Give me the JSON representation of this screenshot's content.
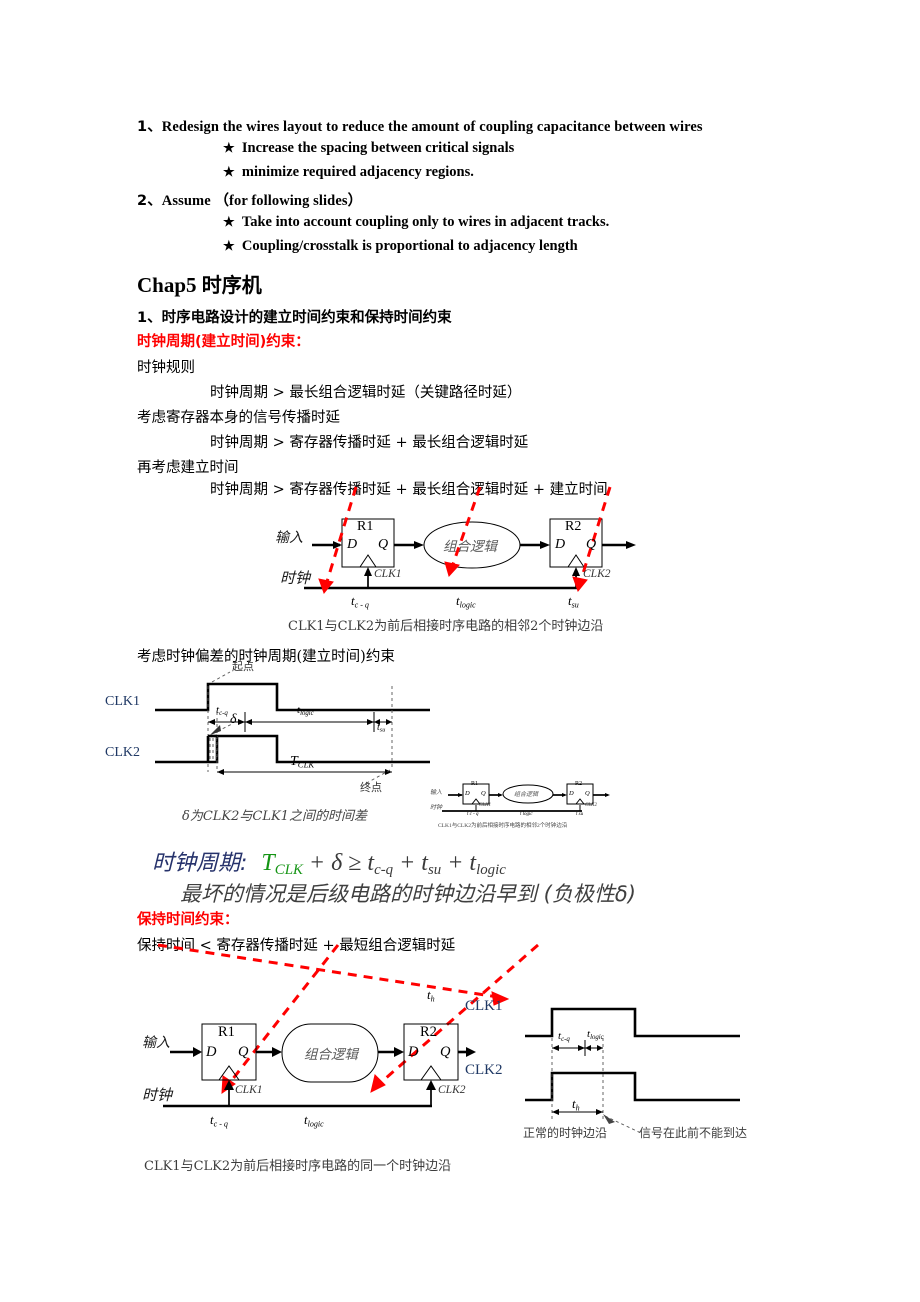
{
  "document": {
    "title": "Chap5 时序机"
  },
  "top_section": {
    "item1": {
      "number": "1、",
      "text": "Redesign the wires layout to reduce the amount of coupling capacitance between wires",
      "bullets": [
        {
          "marker": "★",
          "text": "Increase the spacing between critical signals"
        },
        {
          "marker": "★",
          "text": "minimize required adjacency regions."
        }
      ]
    },
    "item2": {
      "number": "2、",
      "text": "Assume  （for following slides）",
      "bullets": [
        {
          "marker": "★",
          "text": "Take into account coupling only to wires in adjacent tracks."
        },
        {
          "marker": "★",
          "text": "Coupling/crosstalk is proportional to adjacency length"
        }
      ]
    }
  },
  "chapter": {
    "prefix": "Chap5",
    "name": "时序机"
  },
  "setup_section": {
    "heading": "1、时序电路设计的建立时间约束和保持时间约束",
    "red_heading": "时钟周期(建立时间)约束：",
    "lines": [
      "时钟规则",
      "时钟周期  >   最长组合逻辑时延（关键路径时延）",
      "考虑寄存器本身的信号传播时延",
      "时钟周期  >  寄存器传播时延 +  最长组合逻辑时延",
      "再考虑建立时间",
      "时钟周期  >  寄存器传播时延 + 最长组合逻辑时延 + 建立时间"
    ],
    "skew_heading": "考虑时钟偏差的时钟周期(建立时间)约束"
  },
  "circuit1": {
    "input_label": "输入",
    "clock_label": "时钟",
    "reg1": "R1",
    "reg2": "R2",
    "d": "D",
    "q": "Q",
    "logic": "组合逻辑",
    "clk1": "CLK1",
    "clk2": "CLK2",
    "t_cq": "t",
    "t_cq_sub": "c - q",
    "t_logic": "t",
    "t_logic_sub": "logic",
    "t_su": "t",
    "t_su_sub": "su",
    "caption": "CLK1与CLK2为前后相接时序电路的相邻2个时钟边沿"
  },
  "waveform1": {
    "clk1": "CLK1",
    "clk2": "CLK2",
    "start_point": "起点",
    "end_point": "终点",
    "t_cq": "t",
    "t_cq_sub": "c-q",
    "t_logic": "t",
    "t_logic_sub": "logic",
    "t_su": "t",
    "t_su_sub": "su",
    "t_clk": "T",
    "t_clk_sub": "CLK",
    "delta": "δ",
    "caption": "δ为CLK2与CLK1之间的时间差"
  },
  "inset": {
    "reg1": "R1",
    "reg2": "R2",
    "d": "D",
    "q": "Q",
    "logic": "组合逻辑",
    "input_label": "输入",
    "clock_label": "时钟",
    "clk1": "CLK1",
    "clk2": "CLK2",
    "t_cq": "t c - q",
    "t_logic": "t logic",
    "t_su": "t su",
    "caption": "CLK1与CLK2为前后相接时序电路的相邻2个时钟边沿"
  },
  "green_formula": {
    "label": "时钟周期:",
    "expr_t": "T",
    "expr_t_sub": "CLK",
    "expr_rest": " + δ ≥ t",
    "expr_rest_sub1": "c-q",
    "expr_rest2": " + t",
    "expr_rest_sub2": "su",
    "expr_rest3": " + t",
    "expr_rest_sub3": "logic",
    "note": "最坏的情况是后级电路的时钟边沿早到 (负极性δ)"
  },
  "hold_section": {
    "red_heading": "保持时间约束：",
    "line": "保持时间  < 寄存器传播时延 + 最短组合逻辑时延"
  },
  "circuit2": {
    "input_label": "输入",
    "clock_label": "时钟",
    "reg1": "R1",
    "reg2": "R2",
    "d": "D",
    "q": "Q",
    "logic": "组合逻辑",
    "clk1": "CLK1",
    "clk2": "CLK2",
    "t_cq": "t",
    "t_cq_sub": "c - q",
    "t_logic": "t",
    "t_logic_sub": "logic",
    "t_h": "t",
    "t_h_sub": "h",
    "caption": "CLK1与CLK2为前后相接时序电路的同一个时钟边沿"
  },
  "waveform2": {
    "clk1": "CLK1",
    "clk2": "CLK2",
    "t_cq": "t",
    "t_cq_sub": "c-q",
    "t_logic": "t",
    "t_logic_sub": "logic",
    "t_h": "t",
    "t_h_sub": "h",
    "note_left": "正常的时钟边沿",
    "note_right": "信号在此前不能到达"
  },
  "colors": {
    "red": "#ff0000",
    "green": "#149414",
    "navy": "#1f3864",
    "gray": "#5a5a5a"
  }
}
